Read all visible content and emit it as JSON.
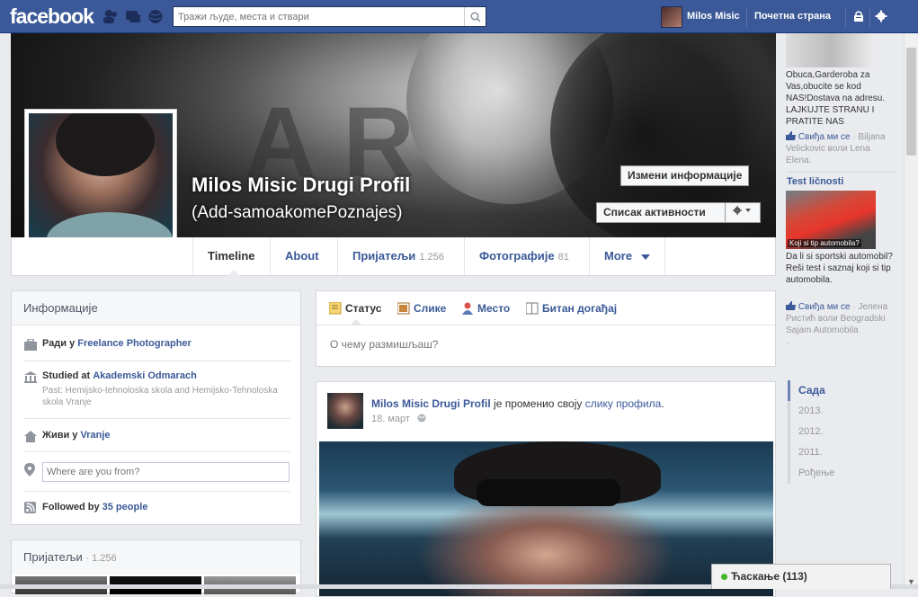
{
  "topbar": {
    "logo": "facebook",
    "search_placeholder": "Тражи људе, места и ствари",
    "user_name": "Milos Misic",
    "home_label": "Почетна страна"
  },
  "cover": {
    "name": "Milos Misic Drugi Profil",
    "alternate_name": "(Add-samoakomePoznajes)",
    "edit_info_label": "Измени информације",
    "activity_log_label": "Списак активности"
  },
  "tabs": [
    {
      "label": "Timeline",
      "count": ""
    },
    {
      "label": "About",
      "count": ""
    },
    {
      "label": "Пријатељи",
      "count": "1.256"
    },
    {
      "label": "Фотографије",
      "count": "81"
    },
    {
      "label": "More",
      "count": ""
    }
  ],
  "info": {
    "title": "Информације",
    "work_prefix": "Ради у",
    "work_place": "Freelance Photographer",
    "study_prefix": "Studied at",
    "study_place": "Akademski Odmarach",
    "study_past": "Past: Hemijsko-tehnoloska skola and Hemijsko-Tehnoloska skola Vranje",
    "lives_prefix": "Живи у",
    "lives_place": "Vranje",
    "where_placeholder": "Where are you from?",
    "followed_prefix": "Followed by",
    "followed_count": "35 people"
  },
  "friends_box": {
    "title": "Пријатељи",
    "count": "· 1.256"
  },
  "composer": {
    "status_label": "Статус",
    "photos_label": "Слике",
    "place_label": "Место",
    "event_label": "Битан догађај",
    "placeholder": "О чему размишљаш?"
  },
  "story": {
    "author": "Milos Misic Drugi Profil",
    "action_text": "је променио своју",
    "action_link": "слику профила",
    "action_end": ".",
    "date": "18. март"
  },
  "ads": {
    "ad1_text": "Obuca,Garderoba za Vas,obucite se kod NAS!Dostava na adresu. LAJKUJTE STRANU I PRATITE NAS",
    "ad1_like": "Свиђа ми се",
    "ad1_social": "· Biljana Velickovic воли Lena Elena.",
    "ad2_title": "Test ličnosti",
    "ad2_caption": "Koji si tip automobila?",
    "ad2_text": "Da li si sportski automobil? Reši test i saznaj koji si tip automobila.",
    "ad2_like": "Свиђа ми се",
    "ad2_social": "· Јелена Ристић воли Beogradski Sajam Automobila",
    "ad2_dot": "."
  },
  "timeline_years": [
    "Сада",
    "2013.",
    "2012.",
    "2011.",
    "Рођење"
  ],
  "chat": {
    "label": "Ћаскање (113)"
  },
  "colors": {
    "brand": "#3b5998",
    "background": "#e9ebee",
    "online": "#42b72a"
  }
}
